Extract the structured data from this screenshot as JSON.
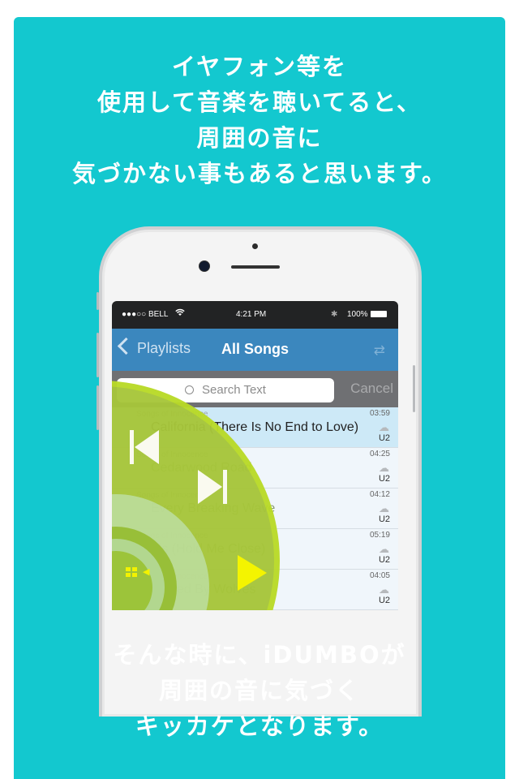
{
  "top_text": {
    "lines": [
      "イヤフォン等を",
      "使用して音楽を聴いてると、",
      "周囲の音に",
      "気づかない事もあると思います。"
    ]
  },
  "bottom_text": {
    "lines": [
      "そんな時に、iDUMBOが",
      "周囲の音に気づく",
      "キッカケとなります。"
    ]
  },
  "colors": {
    "card_background": "#13c8cf",
    "nav_bar": "#3b87be",
    "player_green": "#a7c63a",
    "play_icon": "#f4f400"
  },
  "status_bar": {
    "carrier": "●●●○○ BELL",
    "wifi_icon": "wifi-icon",
    "time": "4:21 PM",
    "bluetooth_icon": "bluetooth-icon",
    "battery": "100%"
  },
  "nav_bar": {
    "back_label": "Playlists",
    "title": "All Songs",
    "repeat_icon": "⇄"
  },
  "search": {
    "placeholder": "Search Text",
    "cancel_label": "Cancel"
  },
  "songs": [
    {
      "title": "California (There Is No End to Love)",
      "subtitle": "Songs of Innocence",
      "duration": "03:59",
      "artist": "U2",
      "active": true
    },
    {
      "title": "Cedarwood Road",
      "subtitle": "Songs of Innocence",
      "duration": "04:25",
      "artist": "U2",
      "active": false
    },
    {
      "title": "Every Breaking Wave",
      "subtitle": "Songs of Innocence",
      "duration": "04:12",
      "artist": "U2",
      "active": false
    },
    {
      "title": "Iris (Hold Me Close)",
      "subtitle": "Songs of Innocence",
      "duration": "05:19",
      "artist": "U2",
      "active": false
    },
    {
      "title": "Raised By Wolves",
      "subtitle": "Songs of Innocence",
      "duration": "04:05",
      "artist": "U2",
      "active": false
    }
  ],
  "player": {
    "prev_icon": "skip-previous-icon",
    "next_icon": "skip-next-icon",
    "play_icon": "play-icon",
    "menu_icon": "grid-icon",
    "volume_icon": "◀"
  }
}
